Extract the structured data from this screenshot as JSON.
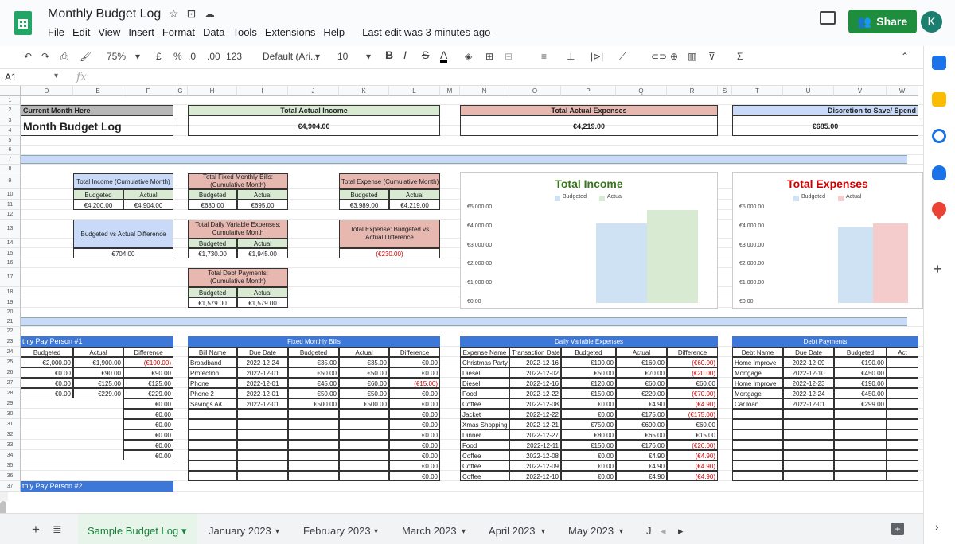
{
  "app": {
    "title": "Monthly Budget Log",
    "menus": [
      "File",
      "Edit",
      "View",
      "Insert",
      "Format",
      "Data",
      "Tools",
      "Extensions",
      "Help"
    ],
    "last_edit": "Last edit was 3 minutes ago",
    "share_label": "Share",
    "avatar_initial": "K",
    "brand_color": "#23a566"
  },
  "toolbar": {
    "zoom": "75%",
    "currency": "£",
    "percent": "%",
    "dec_dec": ".0",
    "dec_inc": ".00",
    "num_fmt": "123",
    "font": "Default (Ari...",
    "font_size": "10",
    "bold": "B",
    "italic": "I",
    "strike": "S",
    "text_color": "A"
  },
  "formula_bar": {
    "cell": "A1",
    "fx": "fx"
  },
  "columns": [
    "D",
    "E",
    "F",
    "G",
    "H",
    "I",
    "J",
    "K",
    "L",
    "M",
    "N",
    "O",
    "P",
    "Q",
    "R",
    "S",
    "T",
    "U",
    "V",
    "W"
  ],
  "rows": [
    "1",
    "2",
    "3",
    "4",
    "5",
    "6",
    "7",
    "8",
    "9",
    "10",
    "11",
    "12",
    "13",
    "14",
    "15",
    "16",
    "17",
    "18",
    "19",
    "20",
    "21",
    "22",
    "23",
    "24",
    "25",
    "26",
    "27",
    "28",
    "29",
    "30",
    "31",
    "32",
    "33",
    "34",
    "35",
    "36",
    "37"
  ],
  "summary": {
    "current_month_label": "Current Month Here",
    "budget_log_title": "Month Budget Log",
    "total_actual_income_label": "Total Actual Income",
    "total_actual_income": "€4,904.00",
    "total_actual_expenses_label": "Total Actual Expenses",
    "total_actual_expenses": "€4,219.00",
    "discretion_label": "Discretion to Save/ Spend",
    "discretion": "€685.00"
  },
  "panels": {
    "income_title": "Total Income (Cumulative Month)",
    "budgeted": "Budgeted",
    "actual": "Actual",
    "income_budgeted": "€4,200.00",
    "income_actual": "€4,904.00",
    "bva_title": "Budgeted vs Actual Difference",
    "bva_value": "€704.00",
    "fixed_title": "Total Fixed Monthly Bills: (Cumulative Month)",
    "fixed_budgeted": "€680.00",
    "fixed_actual": "€695.00",
    "daily_title": "Total Daily Variable Expenses: Cumulative Month",
    "daily_budgeted": "€1,730.00",
    "daily_actual": "€1,945.00",
    "debt_title": "Total Debt Payments: (Cumulative Month)",
    "debt_budgeted": "€1,579.00",
    "debt_actual": "€1,579.00",
    "expense_title": "Total Expense (Cumulative Month)",
    "expense_budgeted": "€3,989.00",
    "expense_actual": "€4,219.00",
    "expense_bva_title": "Total Expense: Budgeted vs Actual Difference",
    "expense_bva_value": "(€230.00)"
  },
  "chart_data": [
    {
      "type": "bar",
      "title": "Total Income",
      "legend": [
        "Budgeted",
        "Actual"
      ],
      "series": [
        {
          "name": "Budgeted",
          "values": [
            4200
          ]
        },
        {
          "name": "Actual",
          "values": [
            4904
          ]
        }
      ],
      "colors": [
        "#cfe2f3",
        "#d9ead3"
      ],
      "title_color": "#38761d",
      "yticks": [
        "€0.00",
        "€1,000.00",
        "€2,000.00",
        "€3,000.00",
        "€4,000.00",
        "€5,000.00"
      ],
      "ylim": [
        0,
        5000
      ]
    },
    {
      "type": "bar",
      "title": "Total Expenses",
      "legend": [
        "Budgeted",
        "Actual"
      ],
      "series": [
        {
          "name": "Budgeted",
          "values": [
            3989
          ]
        },
        {
          "name": "Actual",
          "values": [
            4219
          ]
        }
      ],
      "colors": [
        "#cfe2f3",
        "#f4cccc"
      ],
      "title_color": "#cc0000",
      "yticks": [
        "€0.00",
        "€1,000.00",
        "€2,000.00",
        "€3,000.00",
        "€4,000.00",
        "€5,000.00"
      ],
      "ylim": [
        0,
        5000
      ]
    }
  ],
  "pay": {
    "title": "thly Pay Person #1",
    "headers": [
      "Budgeted",
      "Actual",
      "Difference"
    ],
    "rows": [
      [
        "€2,000.00",
        "€1,900.00",
        "(€100.00)"
      ],
      [
        "€0.00",
        "€90.00",
        "€90.00"
      ],
      [
        "€0.00",
        "€125.00",
        "€125.00"
      ],
      [
        "€0.00",
        "€229.00",
        "€229.00"
      ],
      [
        "",
        "",
        "€0.00"
      ],
      [
        "",
        "",
        "€0.00"
      ],
      [
        "",
        "",
        "€0.00"
      ],
      [
        "",
        "",
        "€0.00"
      ],
      [
        "",
        "",
        "€0.00"
      ],
      [
        "",
        "",
        "€0.00"
      ]
    ],
    "next_title": "thly Pay Person #2"
  },
  "fixed": {
    "title": "Fixed Monthly Bills",
    "headers": [
      "Bill Name",
      "Due Date",
      "Budgeted",
      "Actual",
      "Difference"
    ],
    "rows": [
      [
        "Broadband",
        "2022-12-24",
        "€35.00",
        "€35.00",
        "€0.00"
      ],
      [
        "Protection",
        "2022-12-01",
        "€50.00",
        "€50.00",
        "€0.00"
      ],
      [
        "Phone",
        "2022-12-01",
        "€45.00",
        "€60.00",
        "(€15.00)"
      ],
      [
        "Phone 2",
        "2022-12-01",
        "€50.00",
        "€50.00",
        "€0.00"
      ],
      [
        "Savings A/C",
        "2022-12-01",
        "€500.00",
        "€500.00",
        "€0.00"
      ],
      [
        "",
        "",
        "",
        "",
        "€0.00"
      ],
      [
        "",
        "",
        "",
        "",
        "€0.00"
      ],
      [
        "",
        "",
        "",
        "",
        "€0.00"
      ],
      [
        "",
        "",
        "",
        "",
        "€0.00"
      ],
      [
        "",
        "",
        "",
        "",
        "€0.00"
      ],
      [
        "",
        "",
        "",
        "",
        "€0.00"
      ],
      [
        "",
        "",
        "",
        "",
        "€0.00"
      ]
    ]
  },
  "daily": {
    "title": "Daily Variable Expenses",
    "headers": [
      "Expense Name",
      "Transaction Date",
      "Budgeted",
      "Actual",
      "Difference"
    ],
    "rows": [
      [
        "Christmas Party",
        "2022-12-16",
        "€100.00",
        "€160.00",
        "(€60.00)"
      ],
      [
        "Diesel",
        "2022-12-02",
        "€50.00",
        "€70.00",
        "(€20.00)"
      ],
      [
        "Diesel",
        "2022-12-16",
        "€120.00",
        "€60.00",
        "€60.00"
      ],
      [
        "Food",
        "2022-12-22",
        "€150.00",
        "€220.00",
        "(€70.00)"
      ],
      [
        "Coffee",
        "2022-12-08",
        "€0.00",
        "€4.90",
        "(€4.90)"
      ],
      [
        "Jacket",
        "2022-12-22",
        "€0.00",
        "€175.00",
        "(€175.00)"
      ],
      [
        "Xmas Shopping",
        "2022-12-21",
        "€750.00",
        "€690.00",
        "€60.00"
      ],
      [
        "Dinner",
        "2022-12-27",
        "€80.00",
        "€65.00",
        "€15.00"
      ],
      [
        "Food",
        "2022-12-11",
        "€150.00",
        "€176.00",
        "(€26.00)"
      ],
      [
        "Coffee",
        "2022-12-08",
        "€0.00",
        "€4.90",
        "(€4.90)"
      ],
      [
        "Coffee",
        "2022-12-09",
        "€0.00",
        "€4.90",
        "(€4.90)"
      ],
      [
        "Coffee",
        "2022-12-10",
        "€0.00",
        "€4.90",
        "(€4.90)"
      ]
    ]
  },
  "debt": {
    "title": "Debt Payments",
    "headers": [
      "Debt Name",
      "Due Date",
      "Budgeted",
      "Act"
    ],
    "rows": [
      [
        "Home Improve",
        "2022-12-09",
        "€190.00"
      ],
      [
        "Mortgage",
        "2022-12-10",
        "€450.00"
      ],
      [
        "Home Improve",
        "2022-12-23",
        "€190.00"
      ],
      [
        "Mortgage",
        "2022-12-24",
        "€450.00"
      ],
      [
        "Car loan",
        "2022-12-01",
        "€299.00"
      ]
    ]
  },
  "tabs": [
    "Sample Budget Log",
    "January 2023",
    "February 2023",
    "March 2023",
    "April 2023",
    "May 2023",
    "J"
  ]
}
